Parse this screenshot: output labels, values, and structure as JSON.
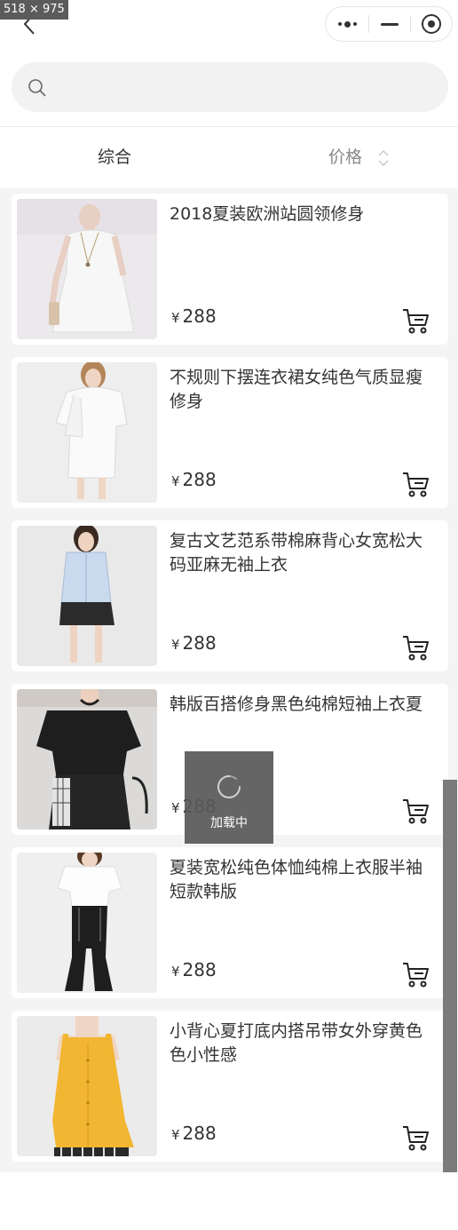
{
  "screenshot_badge": "518 × 975",
  "search": {
    "placeholder": ""
  },
  "filters": {
    "tab_all": "综合",
    "tab_price": "价格"
  },
  "loading": {
    "text": "加载中"
  },
  "products": [
    {
      "title": "2018夏装欧洲站圆领修身",
      "currency": "¥",
      "price": "288"
    },
    {
      "title": "不规则下摆连衣裙女纯色气质显瘦修身",
      "currency": "¥",
      "price": "288"
    },
    {
      "title": "复古文艺范系带棉麻背心女宽松大码亚麻无袖上衣",
      "currency": "¥",
      "price": "288"
    },
    {
      "title": "韩版百搭修身黑色纯棉短袖上衣夏",
      "currency": "¥",
      "price": "288"
    },
    {
      "title": "夏装宽松纯色体恤纯棉上衣服半袖短款韩版",
      "currency": "¥",
      "price": "288"
    },
    {
      "title": "小背心夏打底内搭吊带女外穿黄色色小性感",
      "currency": "¥",
      "price": "288"
    }
  ],
  "colors": {
    "accent_yellow": "#f0b52a",
    "toast_bg": "#585858",
    "page_bg": "#f4f4f4"
  },
  "icons": [
    "back-arrow-icon",
    "more-dots-icon",
    "minimize-icon",
    "target-icon",
    "search-icon",
    "sort-icon",
    "cart-icon",
    "spinner-icon"
  ]
}
